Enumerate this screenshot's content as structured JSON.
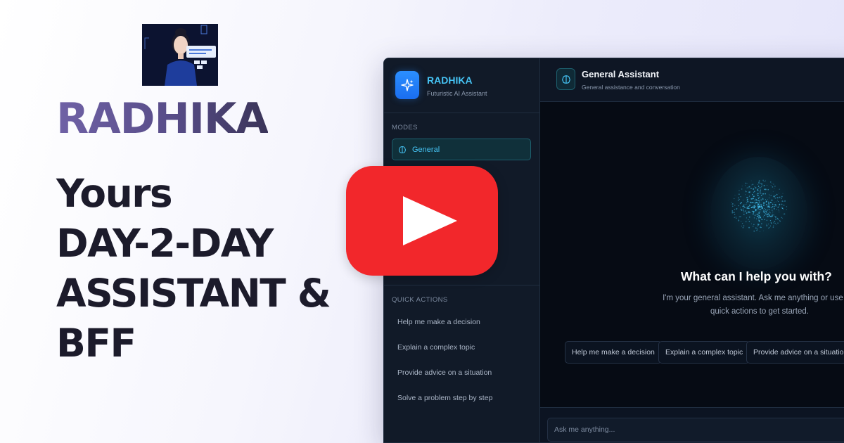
{
  "hero": {
    "brand": "RADHIKA",
    "tagline_lines": [
      "Yours",
      "DAY-2-DAY",
      "ASSISTANT &",
      "BFF"
    ]
  },
  "app": {
    "name": "RADHIKA",
    "subtitle": "Futuristic AI Assistant",
    "modes_label": "MODES",
    "modes": [
      {
        "label": "General",
        "icon": "brain-icon",
        "active": true
      }
    ],
    "quick_actions_label": "QUICK ACTIONS",
    "quick_actions": [
      "Help me make a decision",
      "Explain a complex topic",
      "Provide advice on a situation",
      "Solve a problem step by step"
    ],
    "header": {
      "title": "General Assistant",
      "subtitle": "General assistance and conversation",
      "icon": "brain-icon"
    },
    "welcome": {
      "title": "What can I help you with?",
      "text": "I'm your general assistant. Ask me anything or use the quick actions to get started."
    },
    "chips": [
      "Help me make a decision",
      "Explain a complex topic",
      "Provide advice on a situation"
    ],
    "input": {
      "placeholder": "Ask me anything..."
    }
  },
  "overlay": {
    "icon": "play-icon",
    "color": "#f2272b"
  },
  "colors": {
    "accent": "#46c4f5",
    "app_bg": "#0b1220",
    "brand_gradient": [
      "#7062a6",
      "#3a3458"
    ],
    "tagline": "#1c1b2b"
  }
}
